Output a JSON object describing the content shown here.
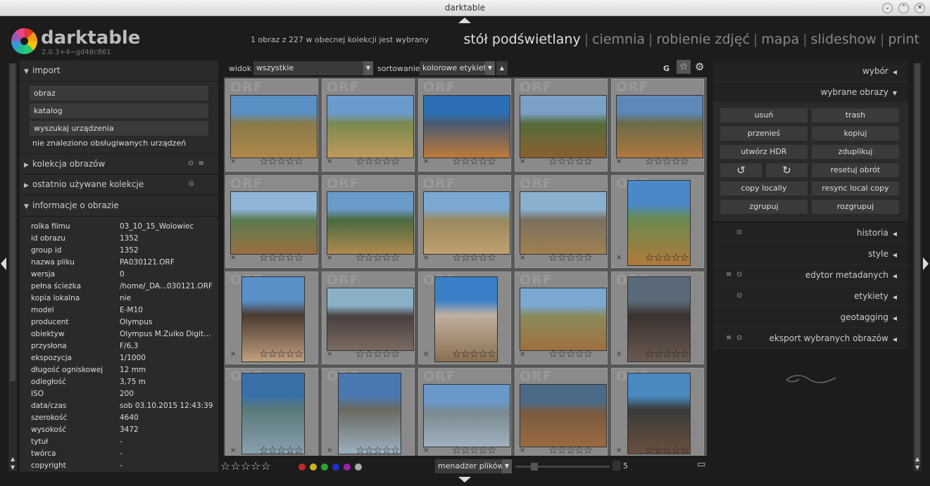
{
  "window": {
    "title": "darktable",
    "buttons": [
      "⌄",
      "⌃",
      "✕"
    ]
  },
  "logo": {
    "name": "darktable",
    "version": "2.0.3+4~gd48c861"
  },
  "status": "1 obraz z 227 w obecnej kolekcji jest wybrany",
  "views": {
    "items": [
      "stół podświetlany",
      "ciemnia",
      "robienie zdjęć",
      "mapa",
      "slideshow",
      "print"
    ],
    "separator": "|"
  },
  "left": {
    "import": {
      "title": "import",
      "buttons": [
        "obraz",
        "katalog",
        "wyszukaj urządzenia"
      ],
      "note": "nie znaleziono obsługiwanych urządzeń"
    },
    "collection": {
      "title": "kolekcja obrazów"
    },
    "recent": {
      "title": "ostatnio używane kolekcje"
    },
    "info": {
      "title": "informacje o obrazie",
      "rows": [
        {
          "k": "rolka filmu",
          "v": "03_10_15_Wolowiec"
        },
        {
          "k": "id obrazu",
          "v": "1352"
        },
        {
          "k": "group id",
          "v": "1352"
        },
        {
          "k": "nazwa pliku",
          "v": "PA030121.ORF"
        },
        {
          "k": "wersja",
          "v": "0"
        },
        {
          "k": "pełna ścieżka",
          "v": "/home/_DA...030121.ORF"
        },
        {
          "k": "kopia lokalna",
          "v": "nie"
        },
        {
          "k": "model",
          "v": "E-M10"
        },
        {
          "k": "producent",
          "v": "Olympus"
        },
        {
          "k": "obiektyw",
          "v": "Olympus M.Zuiko Digital..."
        },
        {
          "k": "przysłona",
          "v": "F/6,3"
        },
        {
          "k": "ekspozycja",
          "v": "1/1000"
        },
        {
          "k": "długość ogniskowej",
          "v": "12 mm"
        },
        {
          "k": "odległość",
          "v": "3,75 m"
        },
        {
          "k": "ISO",
          "v": "200"
        },
        {
          "k": "data/czas",
          "v": "sob 03.10.2015 12:43:39"
        },
        {
          "k": "szerokość",
          "v": "4640"
        },
        {
          "k": "wysokość",
          "v": "3472"
        },
        {
          "k": "tytuł",
          "v": "-"
        },
        {
          "k": "twórca",
          "v": "-"
        },
        {
          "k": "copyright",
          "v": "-"
        }
      ]
    }
  },
  "toolbar": {
    "view_label": "widok",
    "view_value": "wszystkie",
    "sort_label": "sortowanie",
    "sort_value": "kolorowe etykiety",
    "g_label": "G"
  },
  "grid": {
    "watermark": "ORF",
    "reject": "×",
    "stars": "☆☆☆☆☆",
    "first_star": "☆"
  },
  "bottom": {
    "stars": "☆☆☆☆☆",
    "manager": "menadżer plików",
    "zoom": "5",
    "labels": [
      {
        "c": "#c0282a"
      },
      {
        "c": "#c8b41e"
      },
      {
        "c": "#27a52f"
      },
      {
        "c": "#2030c8"
      },
      {
        "c": "#a020b0"
      },
      {
        "c": "#aaaaaa"
      }
    ]
  },
  "right": {
    "wybor": "wybór",
    "selected": {
      "title": "wybrane obrazy",
      "buttons": [
        "usuń",
        "trash",
        "przenieś",
        "kopiuj",
        "utwórz HDR",
        "zduplikuj",
        "↺",
        "↻",
        "resetuj obrót",
        "copy locally",
        "resync local copy",
        "zgrupuj",
        "rozgrupuj"
      ]
    },
    "modules": [
      "historia",
      "style",
      "edytor metadanych",
      "etykiety",
      "geotagging",
      "eksport wybranych obrazów"
    ]
  }
}
